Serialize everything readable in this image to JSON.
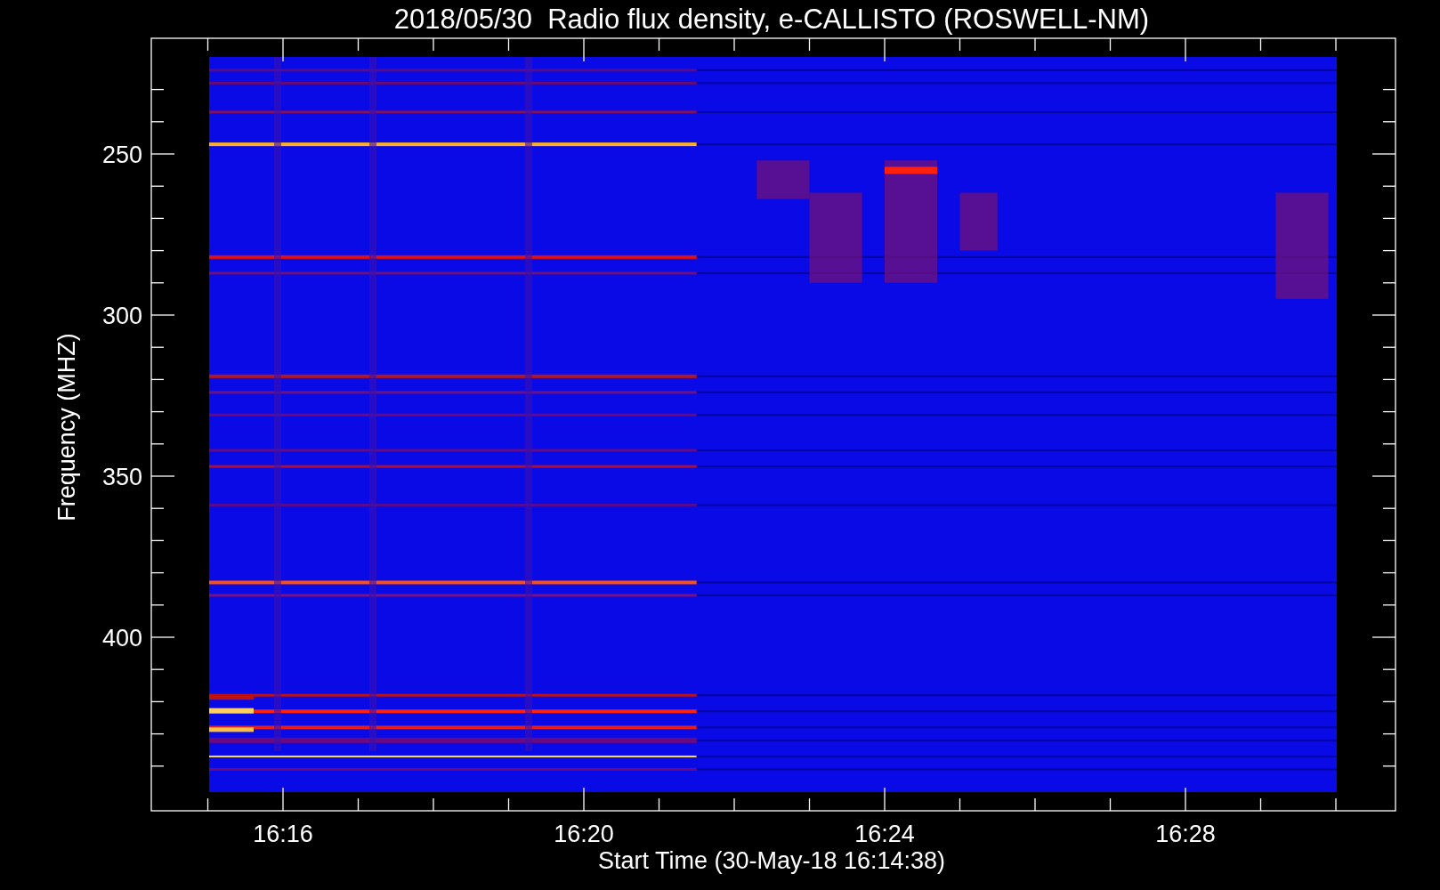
{
  "title": "2018/05/30  Radio flux density, e-CALLISTO (ROSWELL-NM)",
  "y_axis": {
    "label": "Frequency (MHZ)",
    "ticks": [
      "250",
      "300",
      "350",
      "400"
    ]
  },
  "x_axis": {
    "label": "Start Time (30-May-18 16:14:38)",
    "ticks": [
      "16:16",
      "16:20",
      "16:24",
      "16:28"
    ]
  }
}
